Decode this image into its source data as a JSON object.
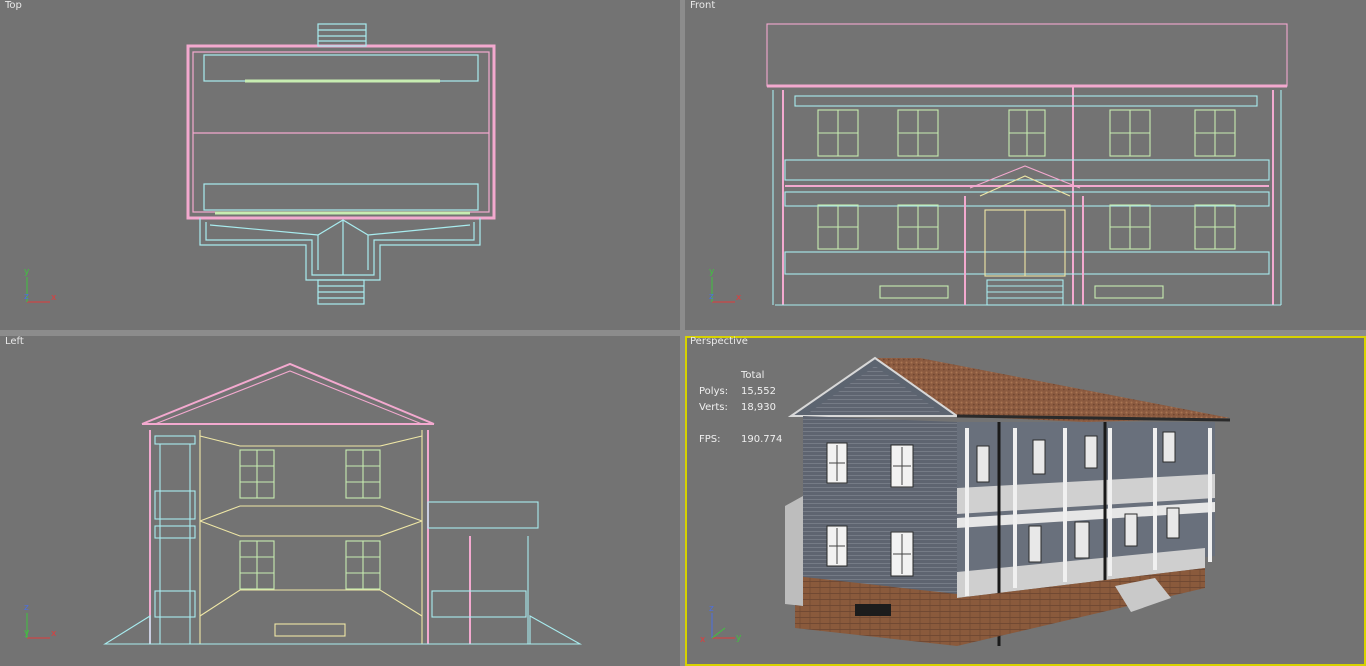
{
  "viewports": {
    "top": {
      "label": "Top",
      "gizmo_axes": [
        "y",
        "z",
        "x"
      ]
    },
    "front": {
      "label": "Front",
      "gizmo_axes": [
        "y",
        "z",
        "x"
      ]
    },
    "left": {
      "label": "Left",
      "gizmo_axes": [
        "z",
        "y",
        "x"
      ]
    },
    "perspective": {
      "label": "Perspective",
      "gizmo_axes": [
        "z",
        "y",
        "x"
      ],
      "stats": {
        "header": "Total",
        "polys_label": "Polys:",
        "polys": "15,552",
        "verts_label": "Verts:",
        "verts": "18,930",
        "fps_label": "FPS:",
        "fps": "190.774"
      }
    }
  },
  "colors": {
    "viewport_bg": "#737373",
    "separator": "#8c8c8c",
    "active_border": "#d7d200",
    "wire_pink": "#f3a9cf",
    "wire_cyan": "#a8ecef",
    "wire_green": "#c7ecb1",
    "wire_yellow": "#efe7a6",
    "axis_x": "#e23b3b",
    "axis_y": "#3fc33f",
    "axis_z": "#4b6fe0"
  }
}
